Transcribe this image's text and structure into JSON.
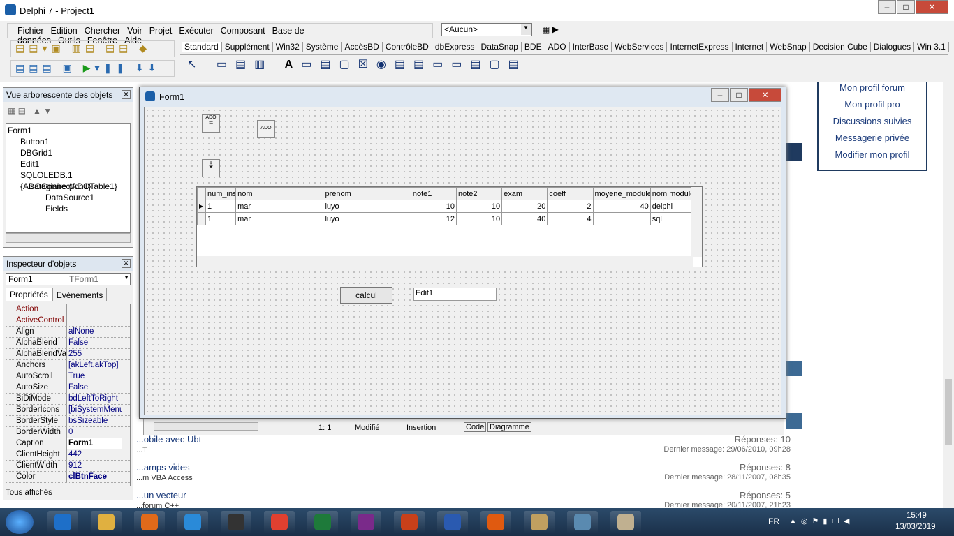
{
  "ide": {
    "title": "Delphi 7 - Project1",
    "menu": [
      "Fichier",
      "Edition",
      "Chercher",
      "Voir",
      "Projet",
      "Exécuter",
      "Composant",
      "Base de données",
      "Outils",
      "Fenêtre",
      "Aide"
    ],
    "combo": "<Aucun>",
    "palette_tabs": [
      "Standard",
      "Supplément",
      "Win32",
      "Système",
      "AccèsBD",
      "ContrôleBD",
      "dbExpress",
      "DataSnap",
      "BDE",
      "ADO",
      "InterBase",
      "WebServices",
      "InternetExpress",
      "Internet",
      "WebSnap",
      "Decision Cube",
      "Dialogues",
      "Win 3.1"
    ]
  },
  "tree": {
    "title": "Vue arborescente des objets",
    "items": [
      "Form1",
      "Button1",
      "DBGrid1",
      "Edit1",
      "SQLOLEDB.1 {ADOConnection1}",
      "satagiaire {ADOTable1}",
      "DataSource1",
      "Fields"
    ]
  },
  "inspector": {
    "title": "Inspecteur d'objets",
    "object": "Form1",
    "type": "TForm1",
    "tabs": [
      "Propriétés",
      "Evénements"
    ],
    "props": [
      [
        "Action",
        ""
      ],
      [
        "ActiveControl",
        ""
      ],
      [
        "Align",
        "alNone"
      ],
      [
        "AlphaBlend",
        "False"
      ],
      [
        "AlphaBlendValue",
        "255"
      ],
      [
        "Anchors",
        "[akLeft,akTop]"
      ],
      [
        "AutoScroll",
        "True"
      ],
      [
        "AutoSize",
        "False"
      ],
      [
        "BiDiMode",
        "bdLeftToRight"
      ],
      [
        "BorderIcons",
        "[biSystemMenu"
      ],
      [
        "BorderStyle",
        "bsSizeable"
      ],
      [
        "BorderWidth",
        "0"
      ],
      [
        "Caption",
        "Form1"
      ],
      [
        "ClientHeight",
        "442"
      ],
      [
        "ClientWidth",
        "912"
      ],
      [
        "Color",
        "clBtnFace"
      ]
    ],
    "footer": "Tous affichés"
  },
  "form": {
    "title": "Form1",
    "columns": [
      "num_ins",
      "nom",
      "prenom",
      "note1",
      "note2",
      "exam",
      "coeff",
      "moyene_module",
      "nom module"
    ],
    "rows": [
      [
        "1",
        "mar",
        "luyo",
        "10",
        "10",
        "20",
        "2",
        "40",
        "delphi"
      ],
      [
        "1",
        "mar",
        "luyo",
        "12",
        "10",
        "40",
        "4",
        "",
        "sql"
      ]
    ],
    "button": "calcul",
    "edit": "Edit1"
  },
  "editor_status": {
    "pos": "1:  1",
    "modified": "Modifié",
    "mode": "Insertion",
    "tabs": [
      "Code",
      "Diagramme"
    ]
  },
  "browser": {
    "links": [
      "Mon profil forum",
      "Mon profil pro",
      "Discussions suivies",
      "Messagerie privée",
      "Modifier mon profil"
    ],
    "topics": [
      {
        "title": "...obile avec Ubt",
        "sub": "...T",
        "replies": "Réponses: 10",
        "last": "Dernier message: 29/06/2010, 09h28"
      },
      {
        "title": "...amps vides",
        "sub": "...m VBA Access",
        "replies": "Réponses: 8",
        "last": "Dernier message: 28/11/2007, 08h35"
      },
      {
        "title": "...un vecteur",
        "sub": "...forum C++",
        "replies": "Réponses: 5",
        "last": "Dernier message: 20/11/2007, 21h23"
      }
    ]
  },
  "taskbar": {
    "lang": "FR",
    "time": "15:49",
    "date": "13/03/2019"
  }
}
